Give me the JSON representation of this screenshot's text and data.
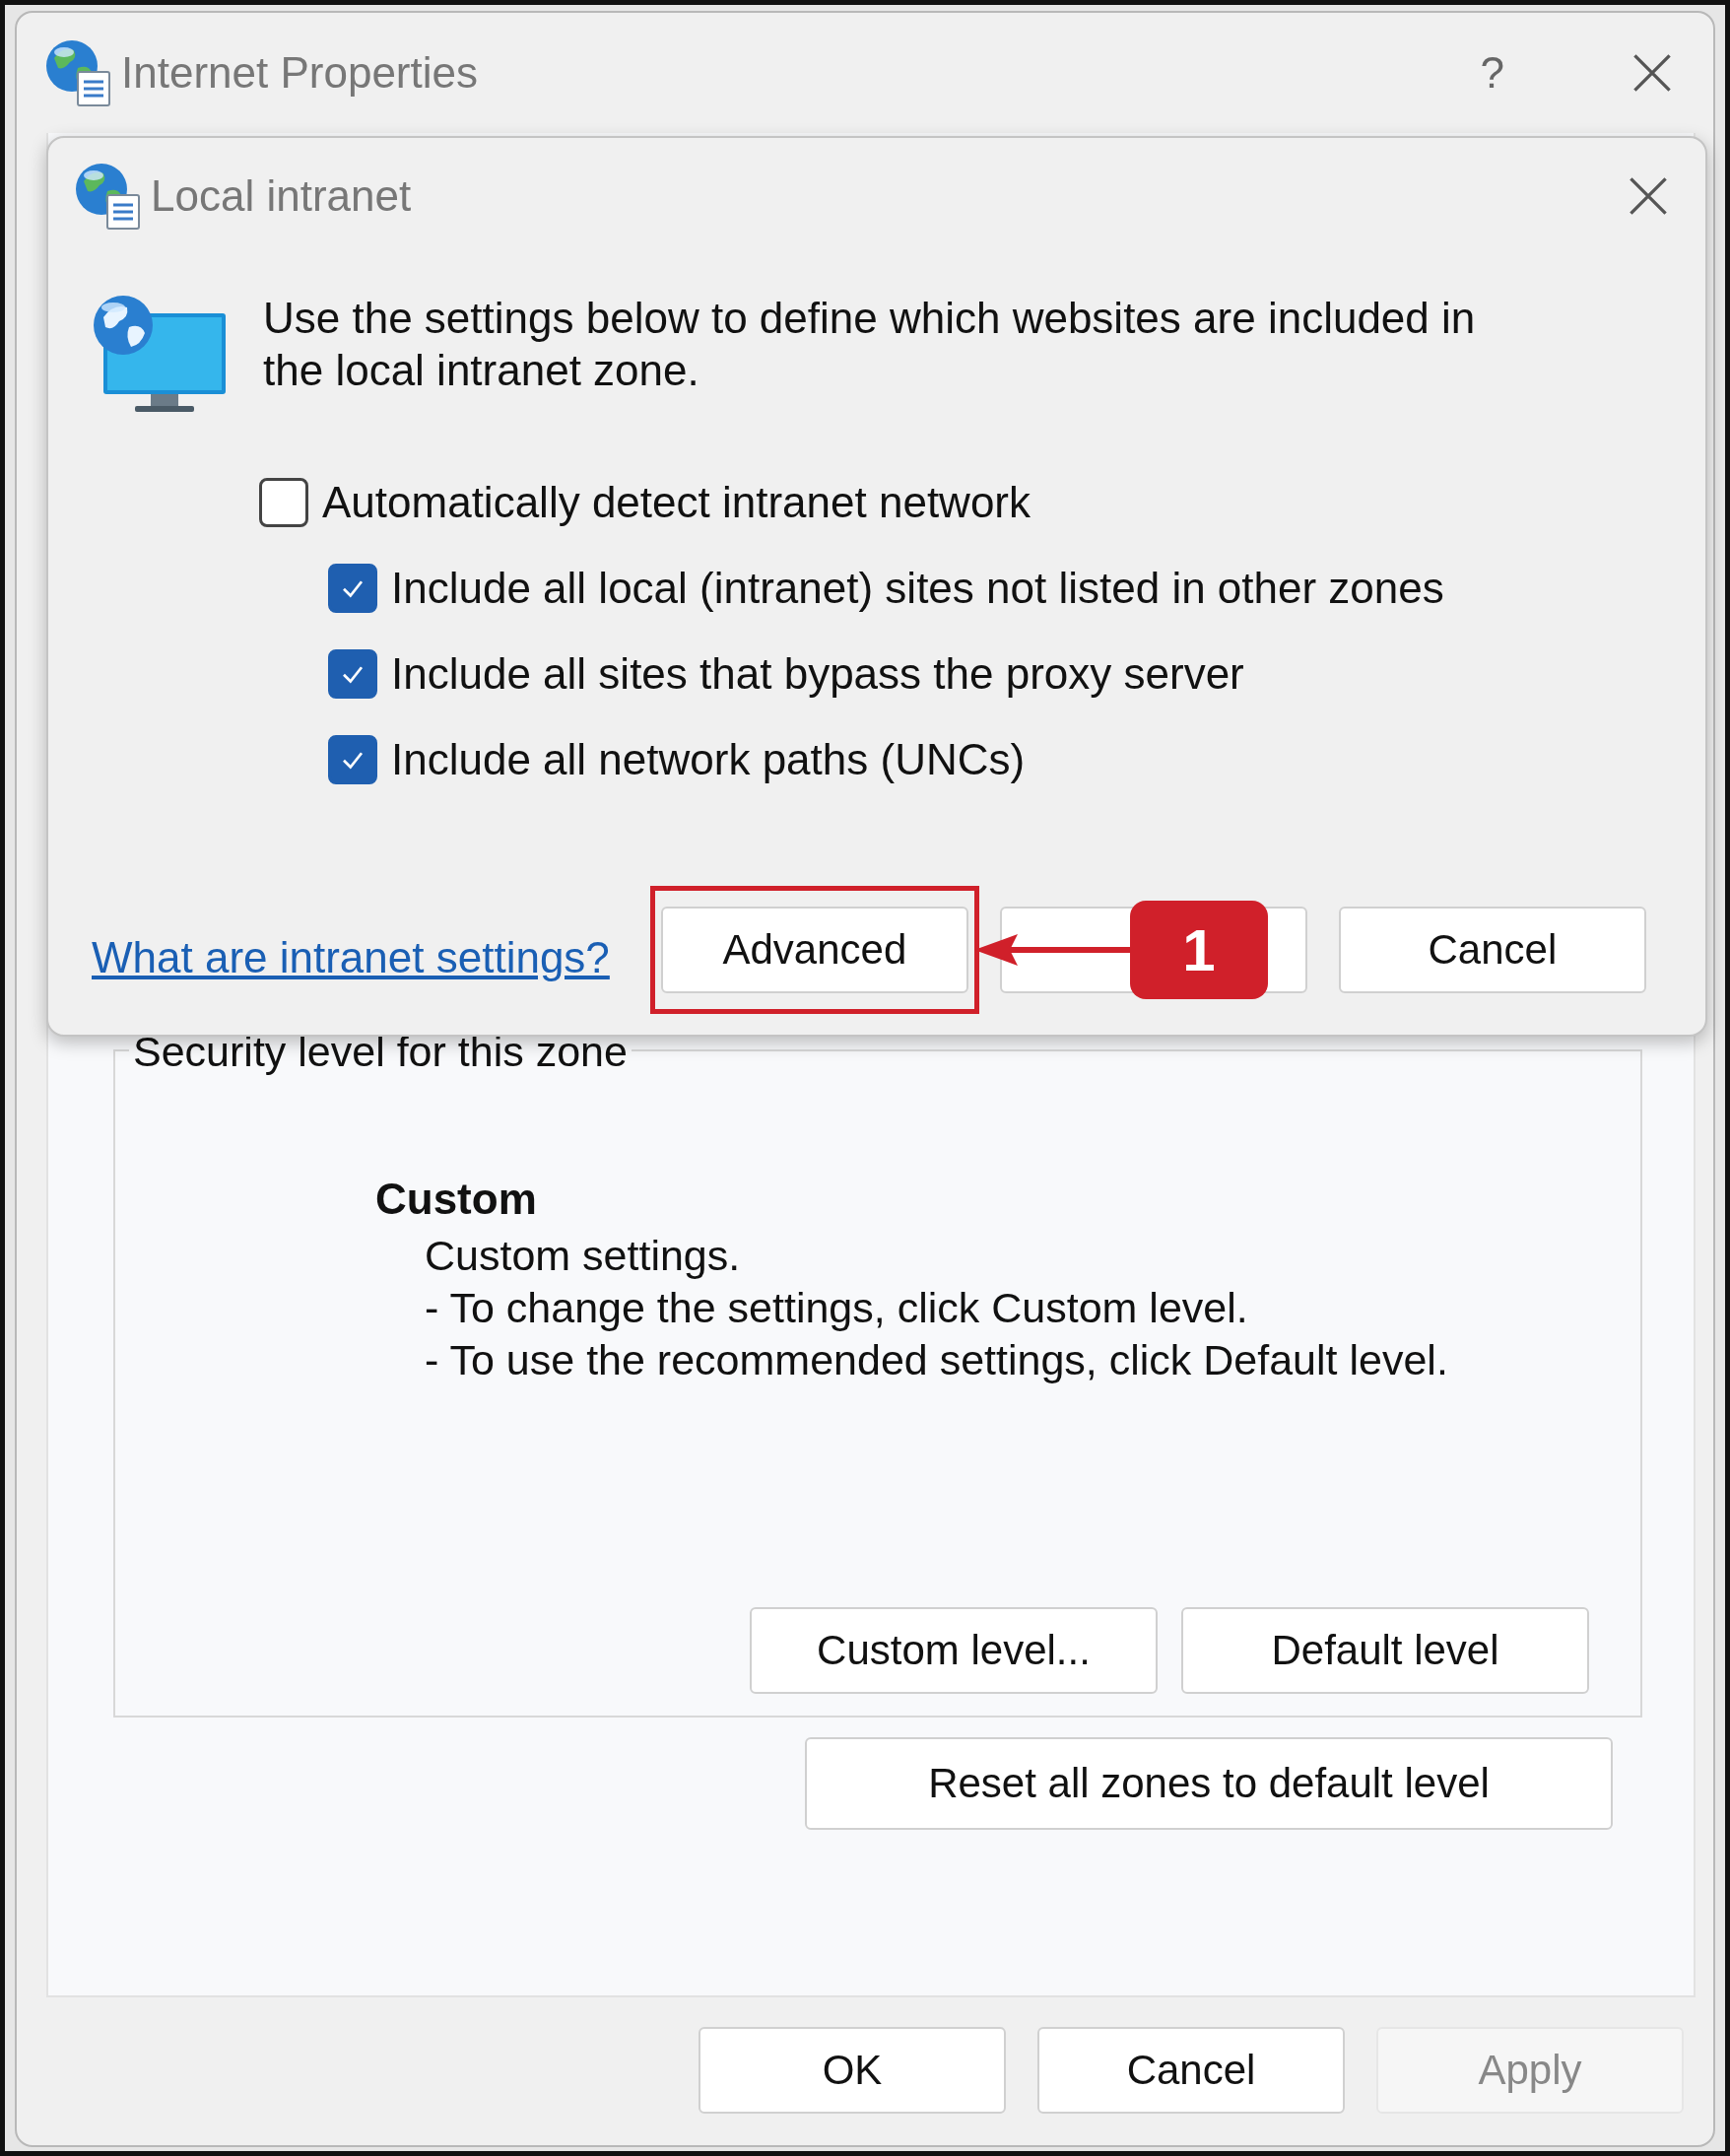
{
  "outer_window": {
    "title": "Internet Properties",
    "help": "?"
  },
  "dialog": {
    "title": "Local intranet",
    "intro": "Use the settings below to define which websites are included in the local intranet zone.",
    "options": [
      {
        "label": "Automatically detect intranet network",
        "checked": false,
        "children": [
          {
            "label": "Include all local (intranet) sites not listed in other zones",
            "checked": true
          },
          {
            "label": "Include all sites that bypass the proxy server",
            "checked": true
          },
          {
            "label": "Include all network paths (UNCs)",
            "checked": true
          }
        ]
      }
    ],
    "help_link": "What are intranet settings?",
    "buttons": [
      {
        "kind": "button",
        "label": "Advanced",
        "highlighted": true
      },
      {
        "kind": "covered",
        "highlighted": false
      },
      {
        "kind": "button",
        "label": "Cancel",
        "highlighted": false
      }
    ],
    "callout": "1"
  },
  "security_group": {
    "label": "Security level for this zone",
    "level_name": "Custom",
    "description": [
      "Custom settings.",
      "- To change the settings, click Custom level.",
      "- To use the recommended settings, click Default level."
    ],
    "buttons": [
      {
        "label": "Custom level..."
      },
      {
        "label": "Default level"
      }
    ]
  },
  "reset_button": "Reset all zones to default level",
  "footer_buttons": [
    {
      "label": "OK",
      "disabled": false
    },
    {
      "label": "Cancel",
      "disabled": false
    },
    {
      "label": "Apply",
      "disabled": true
    }
  ]
}
